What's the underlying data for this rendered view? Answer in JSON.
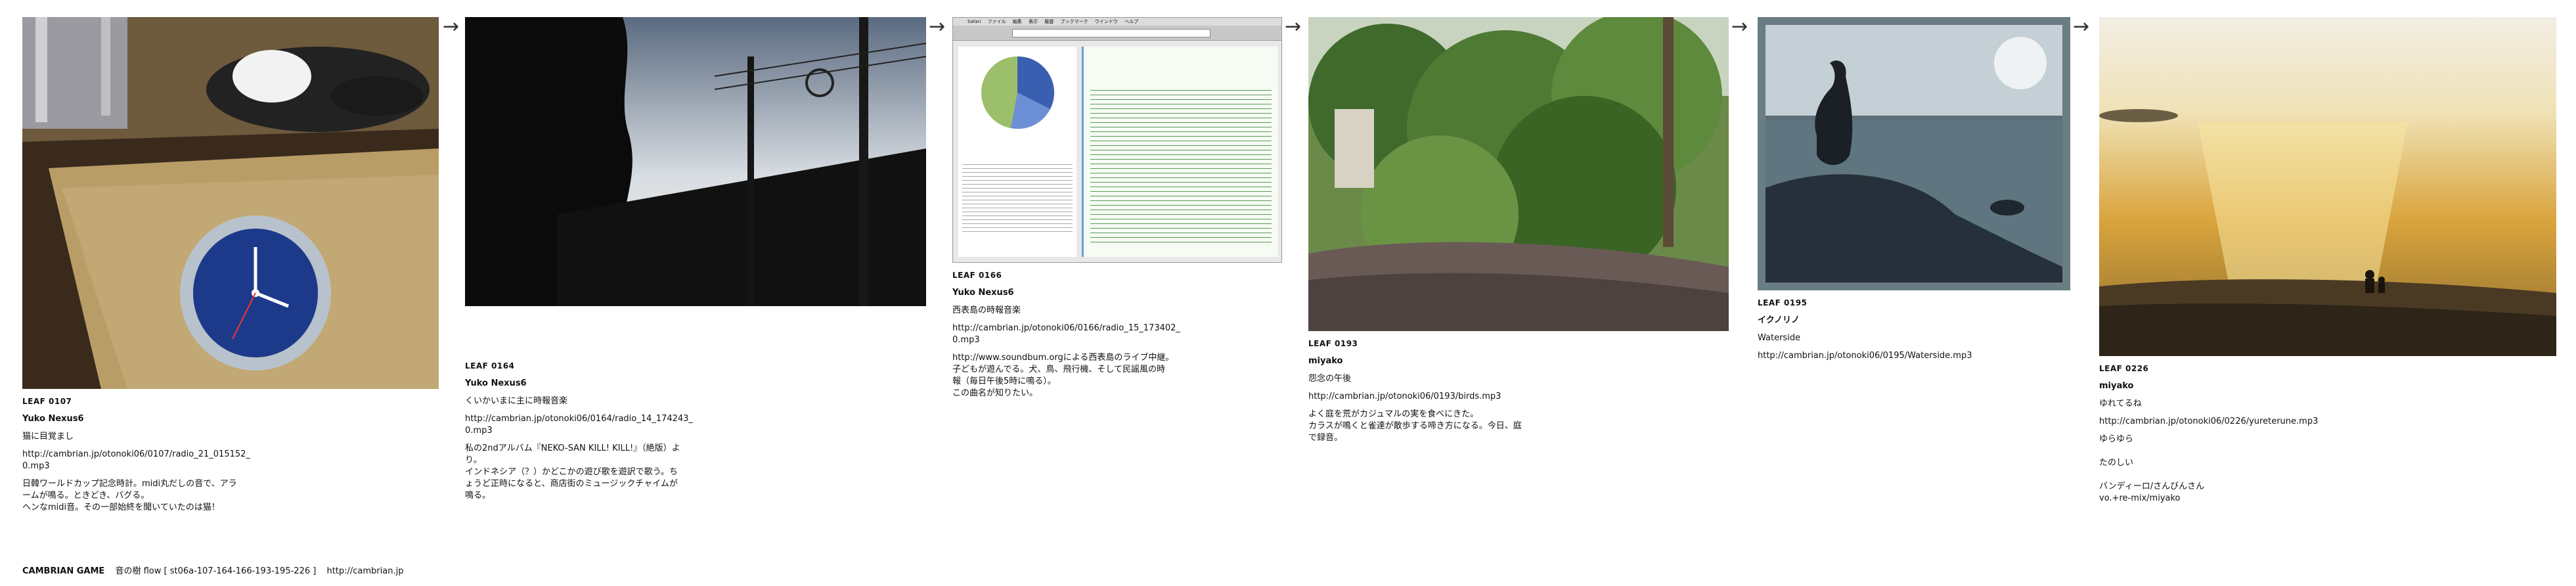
{
  "leaves": [
    {
      "label": "LEAF 0107",
      "artist": "Yuko Nexus6",
      "title": "猫に目覚まし",
      "url": "http://cambrian.jp/otonoki06/0107/radio_21_015152_\n0.mp3",
      "desc": "日韓ワールドカップ記念時計。midi丸だしの音で、アラ\nームが鳴る。ときどき、バグる。\nヘンなmidi音。その一部始終を聞いていたのは猫！"
    },
    {
      "label": "LEAF 0164",
      "artist": "Yuko Nexus6",
      "title": "くいかいまに主に時報音楽",
      "url": "http://cambrian.jp/otonoki06/0164/radio_14_174243_\n0.mp3",
      "desc": "私の2ndアルバム『NEKO-SAN KILL! KILL!』（絶版）よ\nり。\nインドネシア（？）かどこかの遊び歌を遊訳で歌う。ち\nょうど正時になると、商店街のミュージックチャイムが\n鳴る。"
    },
    {
      "label": "LEAF 0166",
      "artist": "Yuko Nexus6",
      "title": "西表島の時報音楽",
      "url": "http://cambrian.jp/otonoki06/0166/radio_15_173402_\n0.mp3",
      "desc": "http://www.soundbum.orgによる西表島のライブ中継。\n子どもが遊んでる。犬、鳥、飛行機、そして民謡風の時\n報（毎日午後5時に鳴る）。\nこの曲名が知りたい。"
    },
    {
      "label": "LEAF 0193",
      "artist": "miyako",
      "title": "怨念の午後",
      "url": "http://cambrian.jp/otonoki06/0193/birds.mp3",
      "desc": "よく庭を荒がカジュマルの実を食べにきた。\nカラスが鳴くと雀達が散歩する啼き方になる。今日、庭\nで録音。"
    },
    {
      "label": "LEAF 0195",
      "artist": "イクノリノ",
      "title": "Waterside",
      "url": "http://cambrian.jp/otonoki06/0195/Waterside.mp3",
      "desc": ""
    },
    {
      "label": "LEAF 0226",
      "artist": "miyako",
      "title": "ゆれてるね",
      "url": "http://cambrian.jp/otonoki06/0226/yureterune.mp3",
      "desc": "      ゆらゆら\n\n         たのしい\n\nバンディーロ/さんびんさん\nvo.+re-mix/miyako"
    }
  ],
  "footer": {
    "game": "CAMBRIAN GAME",
    "flow": "音の樹  flow [ st06a-107-164-166-193-195-226 ]",
    "site": "http://cambrian.jp"
  },
  "window_menu": [
    "Safari",
    "ファイル",
    "編集",
    "表示",
    "履歴",
    "ブックマーク",
    "ウインドウ",
    "ヘルプ"
  ],
  "arrow_glyph": "→"
}
